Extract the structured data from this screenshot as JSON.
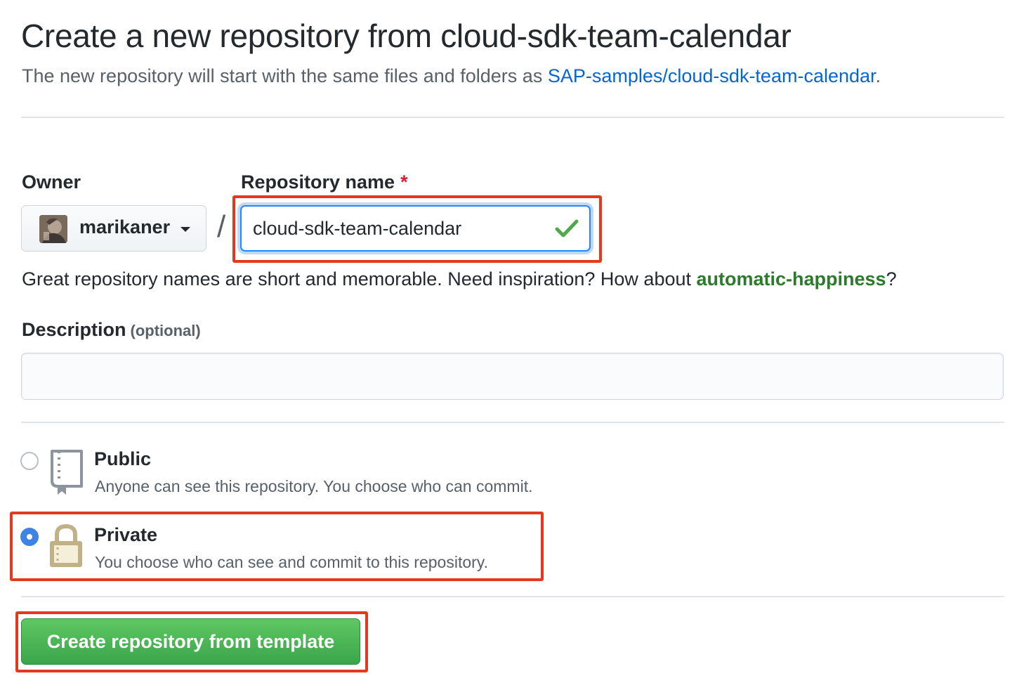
{
  "header": {
    "title": "Create a new repository from cloud-sdk-team-calendar",
    "subtitle_prefix": "The new repository will start with the same files and folders as ",
    "template_link": "SAP-samples/cloud-sdk-team-calendar",
    "subtitle_suffix": "."
  },
  "owner": {
    "label": "Owner",
    "value": "marikaner"
  },
  "separator": "/",
  "repository_name": {
    "label": "Repository name",
    "required_mark": "*",
    "value": "cloud-sdk-team-calendar"
  },
  "name_hint": {
    "prefix": "Great repository names are short and memorable. Need inspiration? How about ",
    "suggestion": "automatic-happiness",
    "suffix": "?"
  },
  "description": {
    "label": "Description",
    "optional": "(optional)",
    "value": ""
  },
  "visibility": {
    "selected": "private",
    "options": [
      {
        "key": "public",
        "title": "Public",
        "description": "Anyone can see this repository. You choose who can commit.",
        "icon": "repo-icon"
      },
      {
        "key": "private",
        "title": "Private",
        "description": "You choose who can see and commit to this repository.",
        "icon": "lock-icon"
      }
    ]
  },
  "submit": {
    "label": "Create repository from template"
  },
  "colors": {
    "link": "#0366d6",
    "suggestion": "#2c7a2c",
    "highlight": "#e2391f",
    "primary_button": "#3aa44a",
    "radio_selected": "#3f84e5"
  }
}
